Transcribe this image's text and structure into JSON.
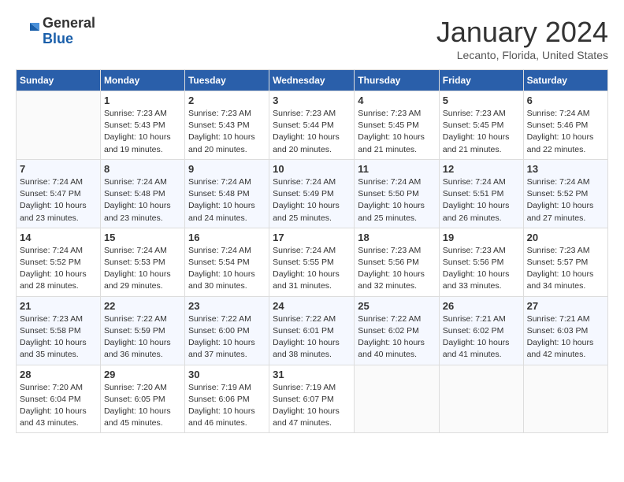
{
  "header": {
    "logo_general": "General",
    "logo_blue": "Blue",
    "month_title": "January 2024",
    "location": "Lecanto, Florida, United States"
  },
  "columns": [
    "Sunday",
    "Monday",
    "Tuesday",
    "Wednesday",
    "Thursday",
    "Friday",
    "Saturday"
  ],
  "weeks": [
    [
      {
        "num": "",
        "info": ""
      },
      {
        "num": "1",
        "info": "Sunrise: 7:23 AM\nSunset: 5:43 PM\nDaylight: 10 hours\nand 19 minutes."
      },
      {
        "num": "2",
        "info": "Sunrise: 7:23 AM\nSunset: 5:43 PM\nDaylight: 10 hours\nand 20 minutes."
      },
      {
        "num": "3",
        "info": "Sunrise: 7:23 AM\nSunset: 5:44 PM\nDaylight: 10 hours\nand 20 minutes."
      },
      {
        "num": "4",
        "info": "Sunrise: 7:23 AM\nSunset: 5:45 PM\nDaylight: 10 hours\nand 21 minutes."
      },
      {
        "num": "5",
        "info": "Sunrise: 7:23 AM\nSunset: 5:45 PM\nDaylight: 10 hours\nand 21 minutes."
      },
      {
        "num": "6",
        "info": "Sunrise: 7:24 AM\nSunset: 5:46 PM\nDaylight: 10 hours\nand 22 minutes."
      }
    ],
    [
      {
        "num": "7",
        "info": "Sunrise: 7:24 AM\nSunset: 5:47 PM\nDaylight: 10 hours\nand 23 minutes."
      },
      {
        "num": "8",
        "info": "Sunrise: 7:24 AM\nSunset: 5:48 PM\nDaylight: 10 hours\nand 23 minutes."
      },
      {
        "num": "9",
        "info": "Sunrise: 7:24 AM\nSunset: 5:48 PM\nDaylight: 10 hours\nand 24 minutes."
      },
      {
        "num": "10",
        "info": "Sunrise: 7:24 AM\nSunset: 5:49 PM\nDaylight: 10 hours\nand 25 minutes."
      },
      {
        "num": "11",
        "info": "Sunrise: 7:24 AM\nSunset: 5:50 PM\nDaylight: 10 hours\nand 25 minutes."
      },
      {
        "num": "12",
        "info": "Sunrise: 7:24 AM\nSunset: 5:51 PM\nDaylight: 10 hours\nand 26 minutes."
      },
      {
        "num": "13",
        "info": "Sunrise: 7:24 AM\nSunset: 5:52 PM\nDaylight: 10 hours\nand 27 minutes."
      }
    ],
    [
      {
        "num": "14",
        "info": "Sunrise: 7:24 AM\nSunset: 5:52 PM\nDaylight: 10 hours\nand 28 minutes."
      },
      {
        "num": "15",
        "info": "Sunrise: 7:24 AM\nSunset: 5:53 PM\nDaylight: 10 hours\nand 29 minutes."
      },
      {
        "num": "16",
        "info": "Sunrise: 7:24 AM\nSunset: 5:54 PM\nDaylight: 10 hours\nand 30 minutes."
      },
      {
        "num": "17",
        "info": "Sunrise: 7:24 AM\nSunset: 5:55 PM\nDaylight: 10 hours\nand 31 minutes."
      },
      {
        "num": "18",
        "info": "Sunrise: 7:23 AM\nSunset: 5:56 PM\nDaylight: 10 hours\nand 32 minutes."
      },
      {
        "num": "19",
        "info": "Sunrise: 7:23 AM\nSunset: 5:56 PM\nDaylight: 10 hours\nand 33 minutes."
      },
      {
        "num": "20",
        "info": "Sunrise: 7:23 AM\nSunset: 5:57 PM\nDaylight: 10 hours\nand 34 minutes."
      }
    ],
    [
      {
        "num": "21",
        "info": "Sunrise: 7:23 AM\nSunset: 5:58 PM\nDaylight: 10 hours\nand 35 minutes."
      },
      {
        "num": "22",
        "info": "Sunrise: 7:22 AM\nSunset: 5:59 PM\nDaylight: 10 hours\nand 36 minutes."
      },
      {
        "num": "23",
        "info": "Sunrise: 7:22 AM\nSunset: 6:00 PM\nDaylight: 10 hours\nand 37 minutes."
      },
      {
        "num": "24",
        "info": "Sunrise: 7:22 AM\nSunset: 6:01 PM\nDaylight: 10 hours\nand 38 minutes."
      },
      {
        "num": "25",
        "info": "Sunrise: 7:22 AM\nSunset: 6:02 PM\nDaylight: 10 hours\nand 40 minutes."
      },
      {
        "num": "26",
        "info": "Sunrise: 7:21 AM\nSunset: 6:02 PM\nDaylight: 10 hours\nand 41 minutes."
      },
      {
        "num": "27",
        "info": "Sunrise: 7:21 AM\nSunset: 6:03 PM\nDaylight: 10 hours\nand 42 minutes."
      }
    ],
    [
      {
        "num": "28",
        "info": "Sunrise: 7:20 AM\nSunset: 6:04 PM\nDaylight: 10 hours\nand 43 minutes."
      },
      {
        "num": "29",
        "info": "Sunrise: 7:20 AM\nSunset: 6:05 PM\nDaylight: 10 hours\nand 45 minutes."
      },
      {
        "num": "30",
        "info": "Sunrise: 7:19 AM\nSunset: 6:06 PM\nDaylight: 10 hours\nand 46 minutes."
      },
      {
        "num": "31",
        "info": "Sunrise: 7:19 AM\nSunset: 6:07 PM\nDaylight: 10 hours\nand 47 minutes."
      },
      {
        "num": "",
        "info": ""
      },
      {
        "num": "",
        "info": ""
      },
      {
        "num": "",
        "info": ""
      }
    ]
  ]
}
